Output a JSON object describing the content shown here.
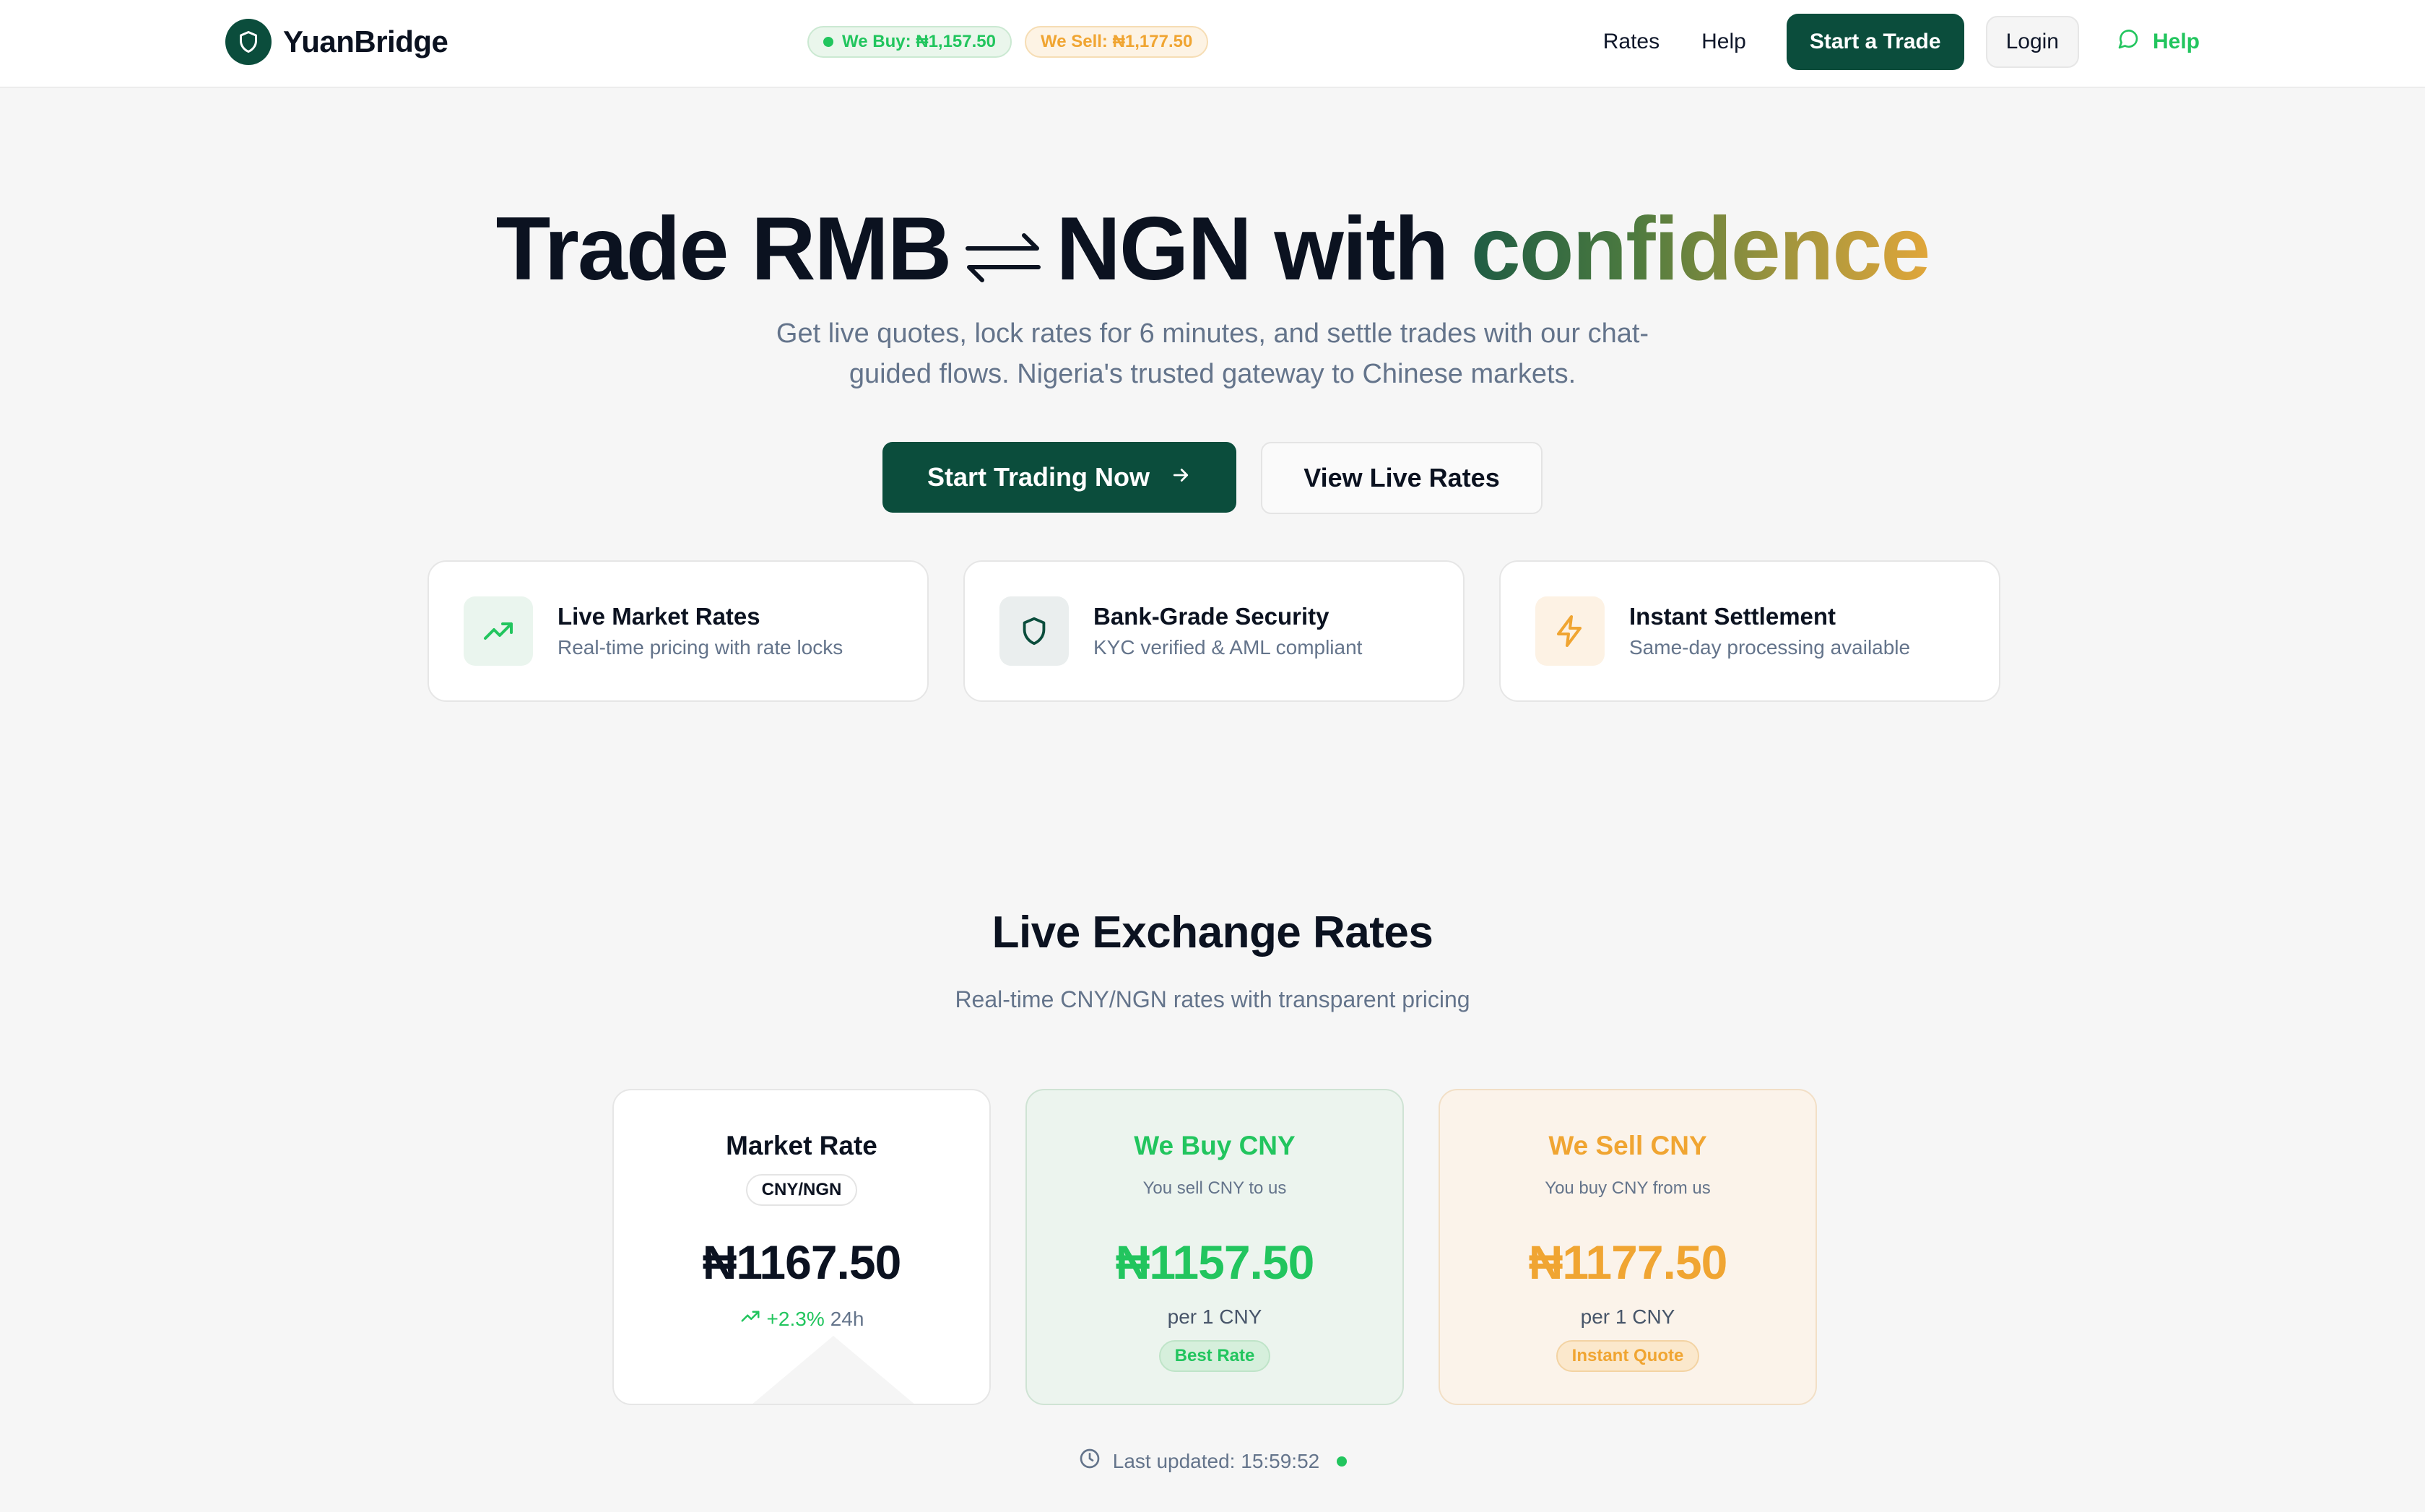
{
  "header": {
    "brand": "YuanBridge",
    "pills": {
      "buy": "We Buy: ₦1,157.50",
      "sell": "We Sell: ₦1,177.50"
    },
    "nav": {
      "rates": "Rates",
      "help": "Help",
      "start_trade": "Start a Trade",
      "login": "Login",
      "help_chat": "Help"
    }
  },
  "hero": {
    "title_part1": "Trade RMB",
    "title_part2": "NGN with",
    "title_highlight": "confidence",
    "subtitle": "Get live quotes, lock rates for 6 minutes, and settle trades with our chat-guided flows. Nigeria's trusted gateway to Chinese markets.",
    "cta_primary": "Start Trading Now",
    "cta_secondary": "View Live Rates"
  },
  "features": [
    {
      "title": "Live Market Rates",
      "desc": "Real-time pricing with rate locks",
      "icon": "trending-up-icon"
    },
    {
      "title": "Bank-Grade Security",
      "desc": "KYC verified & AML compliant",
      "icon": "shield-icon"
    },
    {
      "title": "Instant Settlement",
      "desc": "Same-day processing available",
      "icon": "lightning-icon"
    }
  ],
  "rates": {
    "title": "Live Exchange Rates",
    "subtitle": "Real-time CNY/NGN rates with transparent pricing",
    "market": {
      "title": "Market Rate",
      "pair": "CNY/NGN",
      "value": "₦1167.50",
      "change": "+2.3%",
      "period": "24h"
    },
    "buy": {
      "title": "We Buy CNY",
      "note": "You sell CNY to us",
      "value": "₦1157.50",
      "unit": "per 1 CNY",
      "badge": "Best Rate"
    },
    "sell": {
      "title": "We Sell CNY",
      "note": "You buy CNY from us",
      "value": "₦1177.50",
      "unit": "per 1 CNY",
      "badge": "Instant Quote"
    },
    "last_updated": "Last updated: 15:59:52"
  },
  "colors": {
    "brand": "#0b4d3c",
    "buy_green": "#22c55e",
    "sell_amber": "#f0a532"
  }
}
